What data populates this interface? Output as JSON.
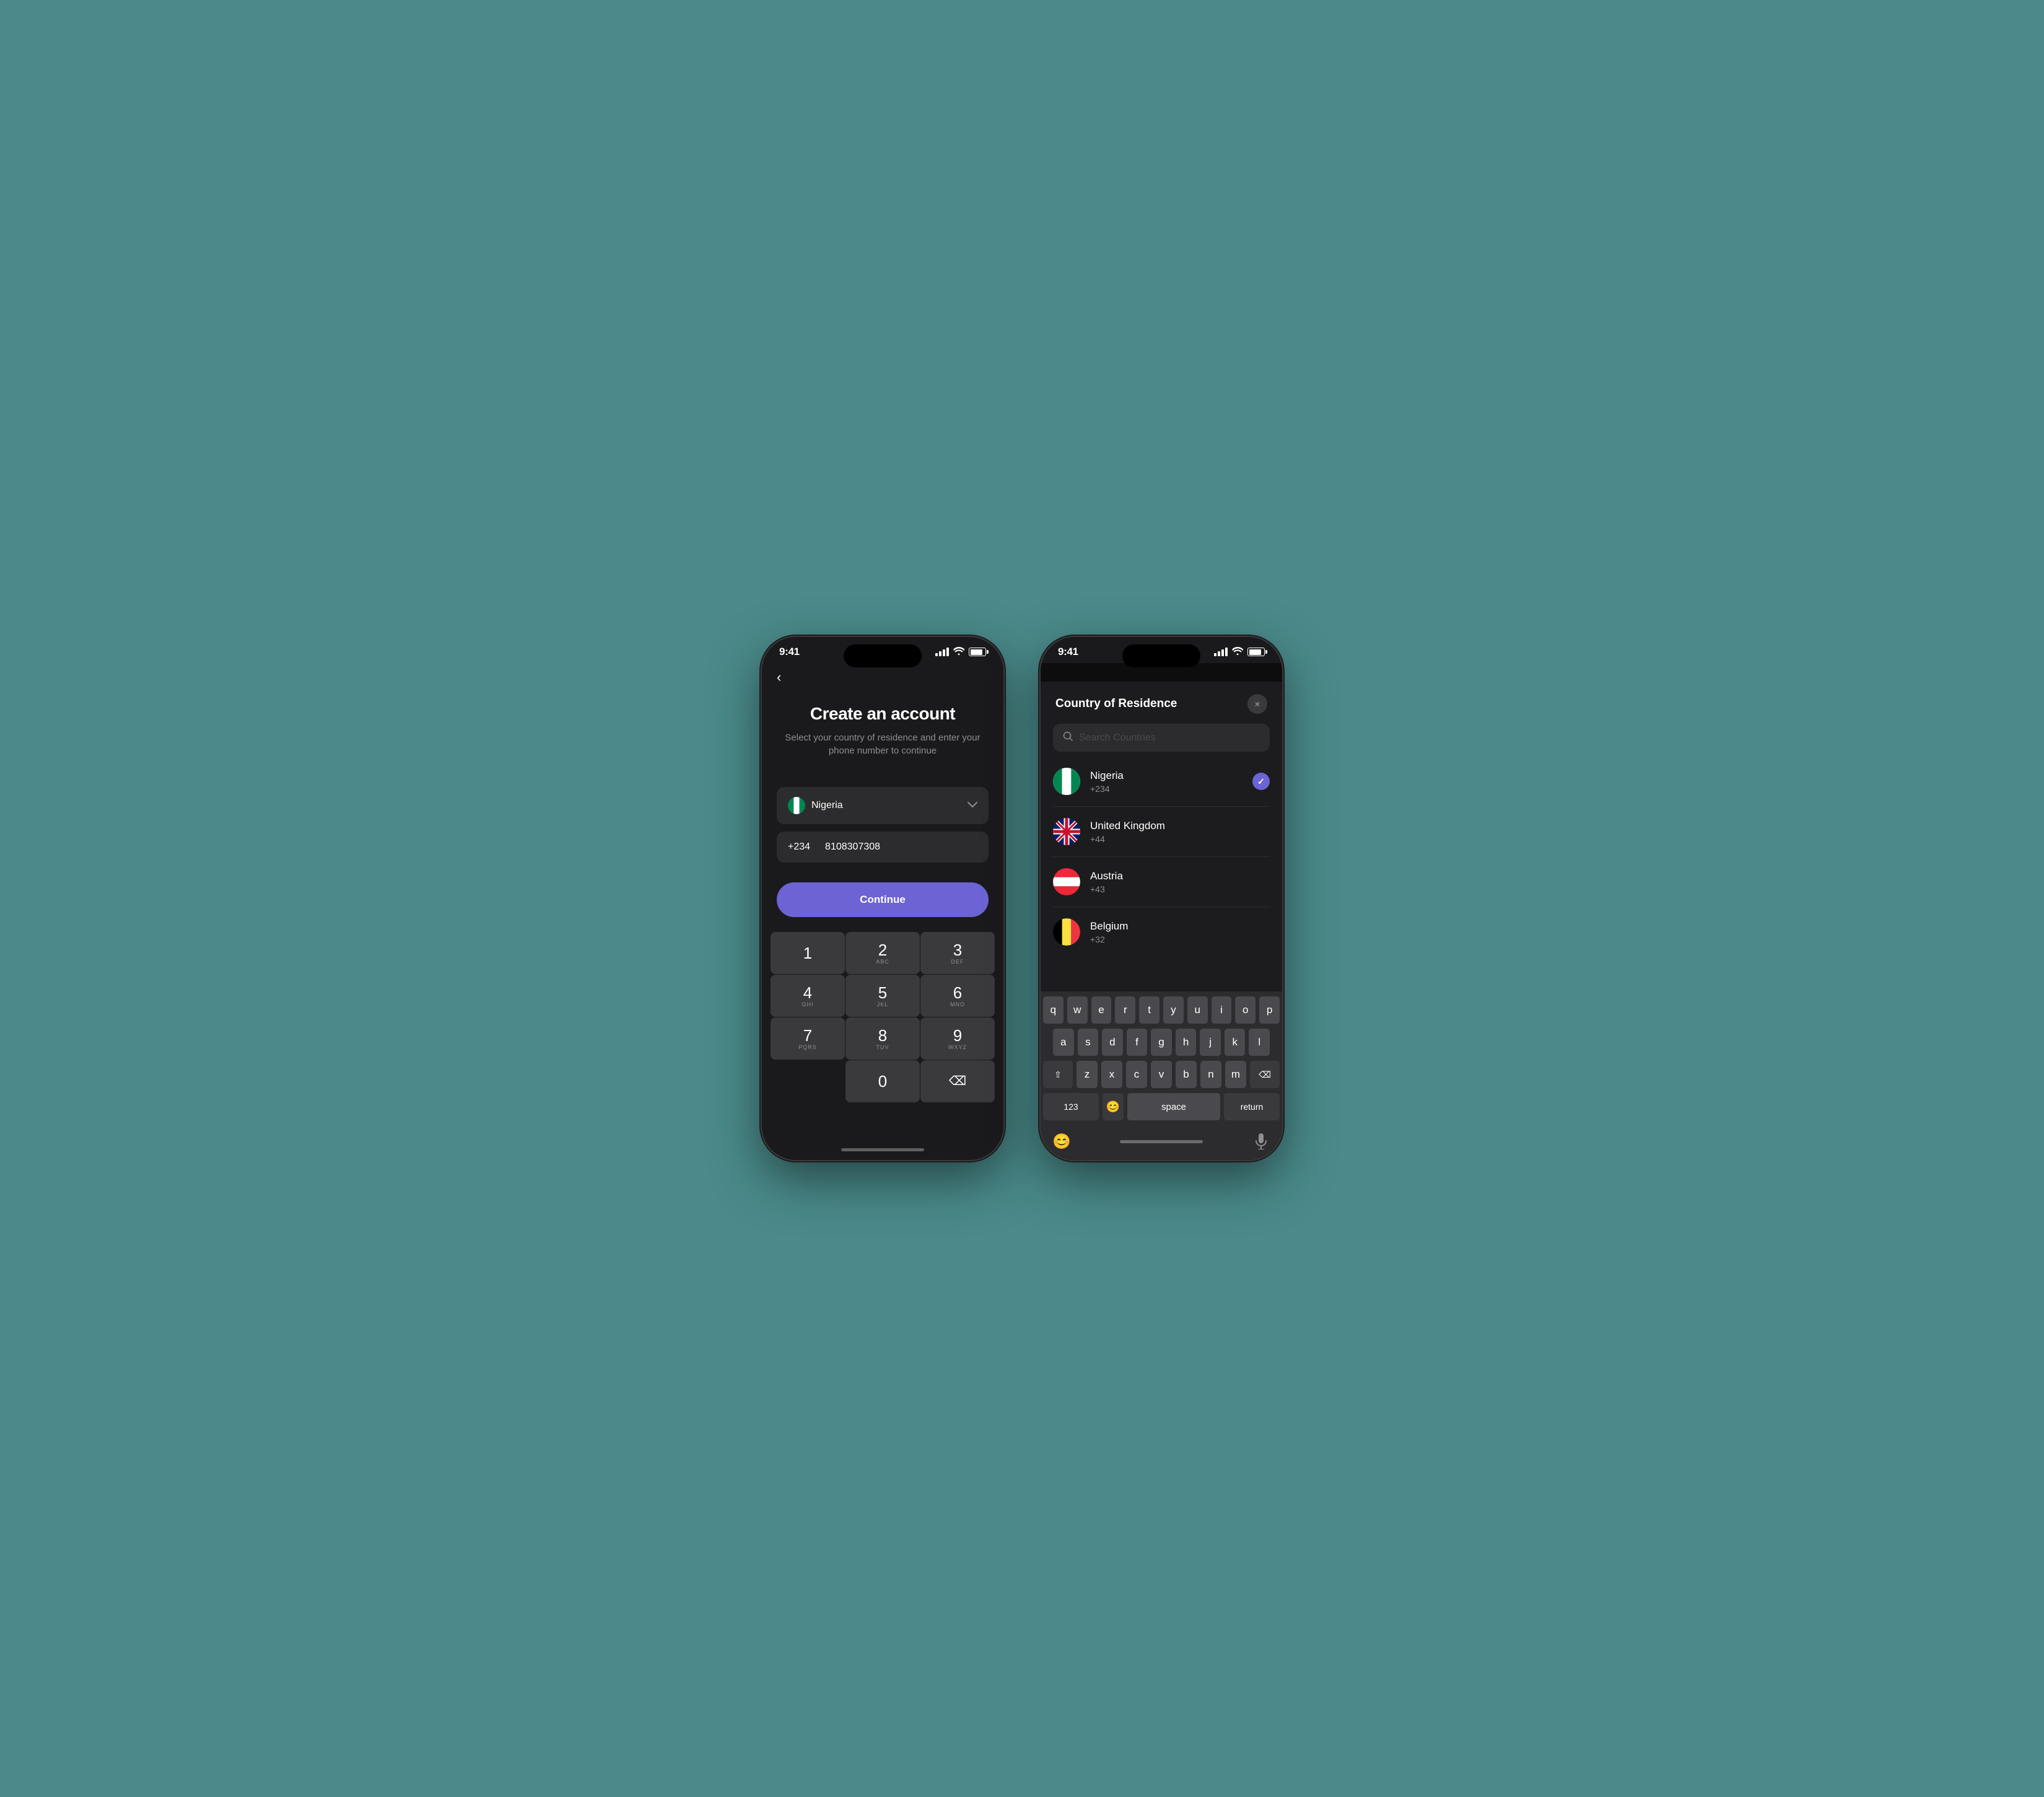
{
  "background": "#4a8a8a",
  "phone1": {
    "status": {
      "time": "9:41"
    },
    "back_button_label": "‹",
    "title": "Create an account",
    "subtitle": "Select your country of residence and\nenter your phone number to continue",
    "country": {
      "name": "Nigeria",
      "code": "+234"
    },
    "phone_number": "8108307308",
    "continue_label": "Continue",
    "numpad": {
      "keys": [
        {
          "number": "1",
          "letters": ""
        },
        {
          "number": "2",
          "letters": "ABC"
        },
        {
          "number": "3",
          "letters": "DEF"
        },
        {
          "number": "4",
          "letters": "GHI"
        },
        {
          "number": "5",
          "letters": "JKL"
        },
        {
          "number": "6",
          "letters": "MNO"
        },
        {
          "number": "7",
          "letters": "PQRS"
        },
        {
          "number": "8",
          "letters": "TUV"
        },
        {
          "number": "9",
          "letters": "WXYZ"
        },
        {
          "number": "0",
          "letters": ""
        }
      ]
    }
  },
  "phone2": {
    "status": {
      "time": "9:41"
    },
    "modal": {
      "title": "Country of Residence",
      "close_label": "×",
      "search_placeholder": "Search Countries",
      "countries": [
        {
          "name": "Nigeria",
          "code": "+234",
          "selected": true
        },
        {
          "name": "United Kingdom",
          "code": "+44",
          "selected": false
        },
        {
          "name": "Austria",
          "code": "+43",
          "selected": false
        },
        {
          "name": "Belgium",
          "code": "+32",
          "selected": false
        }
      ]
    },
    "keyboard": {
      "row1": [
        "q",
        "w",
        "e",
        "r",
        "t",
        "y",
        "u",
        "i",
        "o",
        "p"
      ],
      "row2": [
        "a",
        "s",
        "d",
        "f",
        "g",
        "h",
        "j",
        "k",
        "l"
      ],
      "row3": [
        "z",
        "x",
        "c",
        "v",
        "b",
        "n",
        "m"
      ],
      "num_label": "123",
      "space_label": "space",
      "return_label": "return"
    }
  }
}
